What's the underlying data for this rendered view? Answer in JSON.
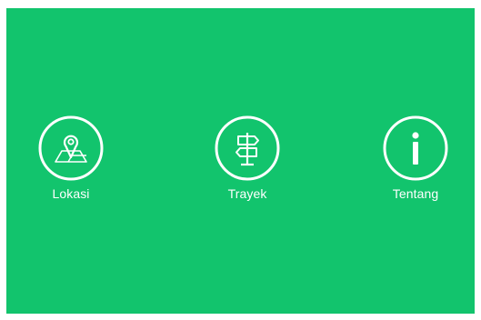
{
  "theme": {
    "background": "#12c46d",
    "foreground": "#ffffff"
  },
  "menu": {
    "items": [
      {
        "label": "Lokasi",
        "icon": "map-pin-icon"
      },
      {
        "label": "Trayek",
        "icon": "signpost-icon"
      },
      {
        "label": "Tentang",
        "icon": "info-icon"
      }
    ]
  }
}
